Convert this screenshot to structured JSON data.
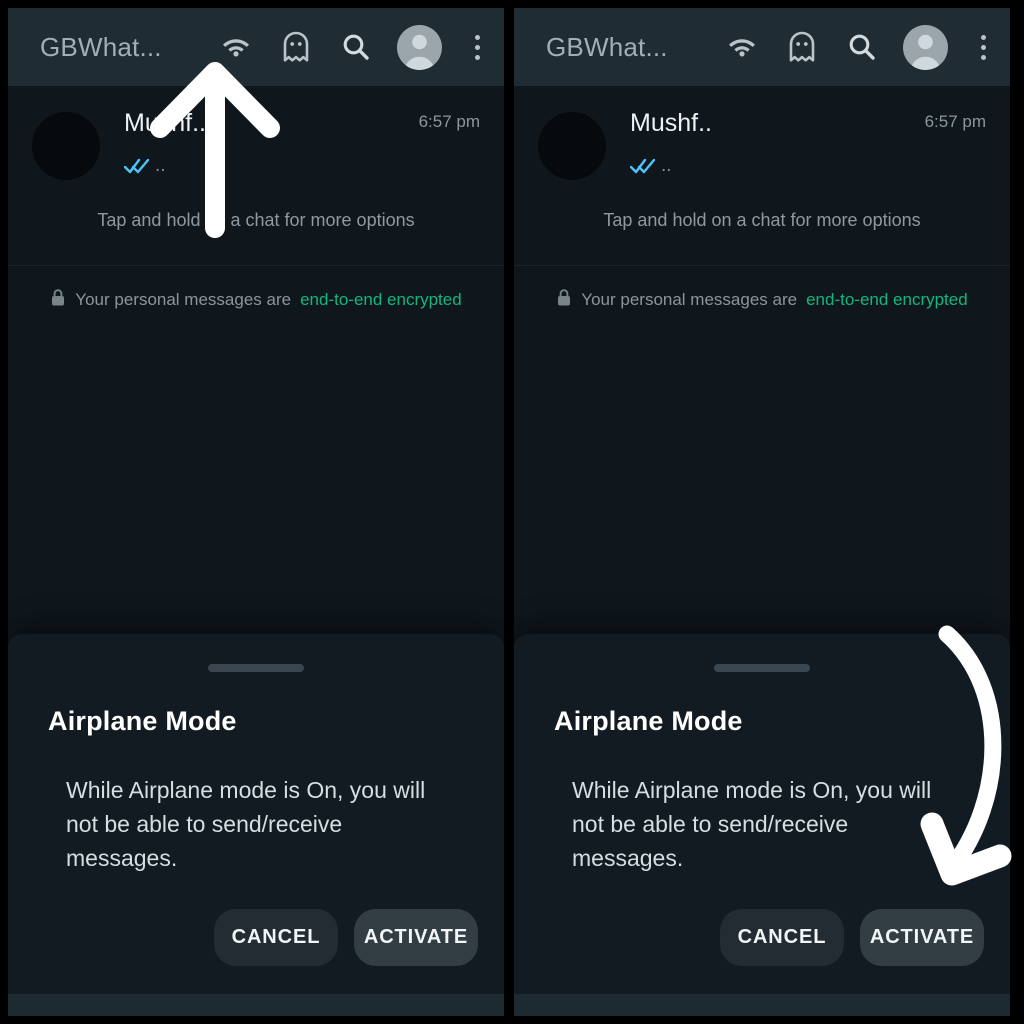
{
  "screen": {
    "app_bar": {
      "title": "GBWhat...",
      "icons": [
        {
          "name": "wifi-icon",
          "label": "Wi-Fi"
        },
        {
          "name": "ghost-icon",
          "label": "Ghost mode"
        },
        {
          "name": "search-icon",
          "label": "Search"
        },
        {
          "name": "avatar-icon",
          "label": "Profile"
        },
        {
          "name": "more-options-icon",
          "label": "More options"
        }
      ],
      "bg_color": "#1f2c34",
      "title_color": "#9fb0b8"
    },
    "chat_list": {
      "rows": [
        {
          "name": "Mushf..",
          "time": "6:57 pm",
          "preview": "..",
          "status_icon": "double-check-icon",
          "status_color": "#4fc3f7"
        }
      ],
      "hint": "Tap and hold on a chat for more options",
      "encryption": {
        "lock_icon": "lock-icon",
        "text": "Your personal messages are ",
        "link": "end-to-end encrypted",
        "link_color": "#12b67d"
      }
    },
    "bottom_sheet": {
      "handle": "drag-handle",
      "title": "Airplane Mode",
      "body": "While Airplane mode is On, you will not be able to send/receive messages.",
      "buttons": [
        {
          "name": "cancel-button",
          "label": "CANCEL",
          "bg": "#222c32"
        },
        {
          "name": "activate-button",
          "label": "ACTIVATE",
          "bg": "#323d44"
        }
      ]
    },
    "background_color": "#0f171d"
  },
  "annotations": [
    {
      "name": "up-arrow-annotation",
      "points_to": "wifi-icon",
      "panel": "left",
      "color": "#ffffff"
    },
    {
      "name": "curved-down-arrow-annotation",
      "points_to": "activate-button",
      "panel": "right",
      "color": "#ffffff"
    }
  ]
}
